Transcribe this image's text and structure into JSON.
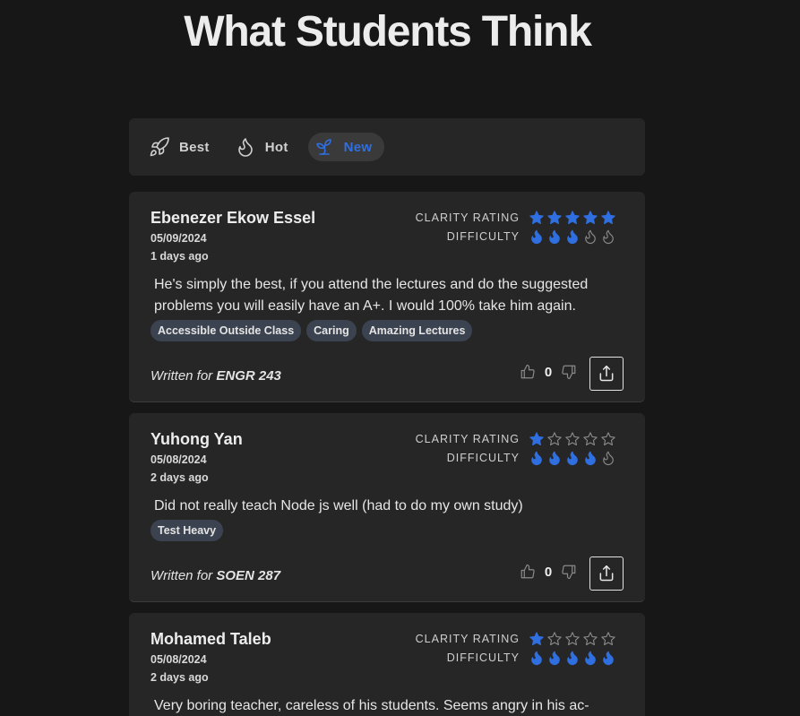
{
  "page": {
    "title": "What Students Think"
  },
  "sort": {
    "options": [
      {
        "label": "Best",
        "icon": "rocket-icon",
        "active": false
      },
      {
        "label": "Hot",
        "icon": "flame-icon",
        "active": false
      },
      {
        "label": "New",
        "icon": "sprout-icon",
        "active": true
      }
    ]
  },
  "labels": {
    "clarity": "CLARITY RATING",
    "difficulty": "DIFFICULTY",
    "written_for": "Written for"
  },
  "colors": {
    "accent": "#2f6fe0",
    "empty_icon": "#8a8a8a",
    "tag_bg": "#3c4350"
  },
  "reviews": [
    {
      "name": "Ebenezer Ekow Essel",
      "date": "05/09/2024",
      "ago": "1 days ago",
      "clarity": 5,
      "difficulty": 3,
      "comment": "He's simply the best, if you attend the lectures and do the suggested problems you will easily have an A+. I would 100% take him again.",
      "tags": [
        "Accessible Outside Class",
        "Caring",
        "Amazing Lectures"
      ],
      "course": "ENGR 243",
      "votes": "0"
    },
    {
      "name": "Yuhong Yan",
      "date": "05/08/2024",
      "ago": "2 days ago",
      "clarity": 1,
      "difficulty": 4,
      "comment": "Did not really teach Node js well (had to do my own study)",
      "tags": [
        "Test Heavy"
      ],
      "course": "SOEN 287",
      "votes": "0"
    },
    {
      "name": "Mohamed Taleb",
      "date": "05/08/2024",
      "ago": "2 days ago",
      "clarity": 1,
      "difficulty": 5,
      "comment": "Very boring teacher, careless of his students. Seems angry in his ac-",
      "tags": [],
      "course": "",
      "votes": ""
    }
  ]
}
